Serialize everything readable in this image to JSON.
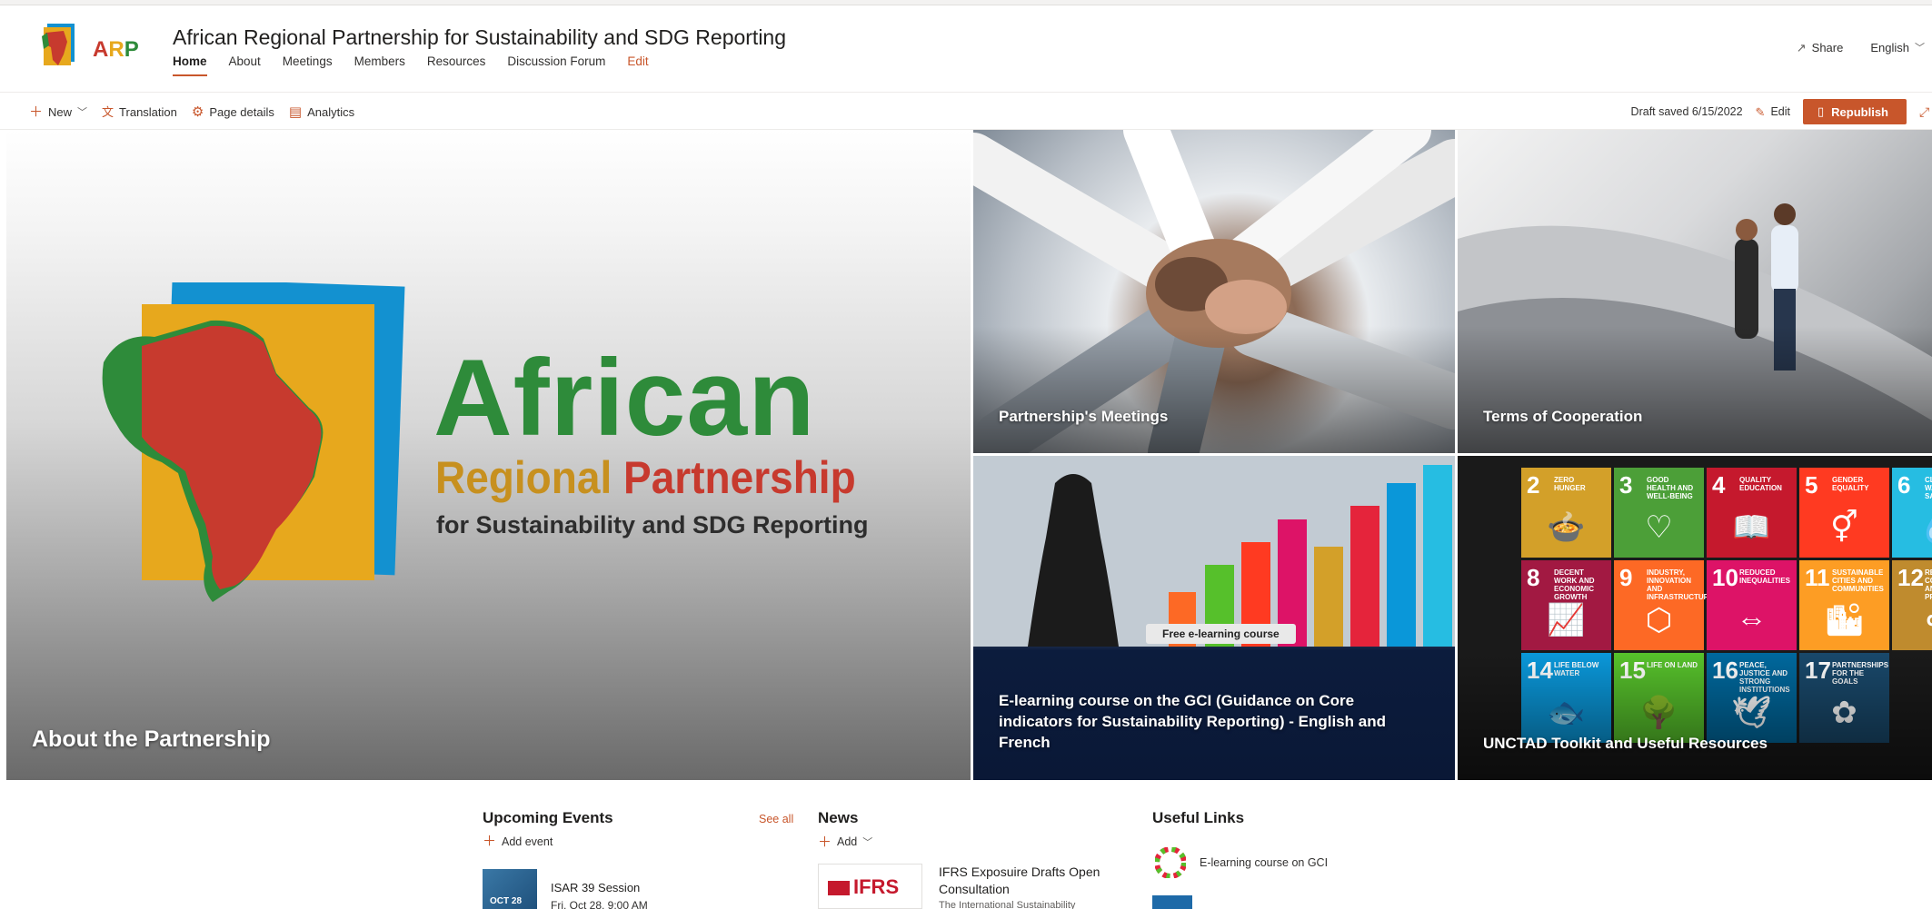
{
  "site": {
    "logo_text": "ARP",
    "title": "African Regional Partnership for Sustainability and SDG Reporting",
    "nav": [
      {
        "label": "Home",
        "active": true
      },
      {
        "label": "About"
      },
      {
        "label": "Meetings"
      },
      {
        "label": "Members"
      },
      {
        "label": "Resources"
      },
      {
        "label": "Discussion Forum"
      },
      {
        "label": "Edit"
      }
    ],
    "share_label": "Share",
    "language_label": "English"
  },
  "commandbar": {
    "new_label": "New",
    "translation_label": "Translation",
    "page_details_label": "Page details",
    "analytics_label": "Analytics",
    "draft_status": "Draft saved 6/15/2022",
    "edit_label": "Edit",
    "republish_label": "Republish"
  },
  "hero": {
    "brand": {
      "line1": "African",
      "line2a": "Regional",
      "line2b": "Partnership",
      "line3": "for Sustainability and SDG Reporting"
    },
    "tiles": [
      {
        "label": "About the Partnership"
      },
      {
        "label": "Partnership's Meetings"
      },
      {
        "label": "Terms of Cooperation"
      },
      {
        "label": "E-learning course on the GCI (Guidance on Core indicators for Sustainability Reporting) - English and French",
        "pill": "Free e-learning course"
      },
      {
        "label": "UNCTAD Toolkit and Useful Resources"
      }
    ],
    "sdg_tiles": [
      {
        "num": "2",
        "cap": "ZERO HUNGER",
        "color": "#d3a029",
        "glyph": "🍲"
      },
      {
        "num": "3",
        "cap": "GOOD HEALTH AND WELL-BEING",
        "color": "#4c9f38",
        "glyph": "♡"
      },
      {
        "num": "4",
        "cap": "QUALITY EDUCATION",
        "color": "#c5192d",
        "glyph": "📖"
      },
      {
        "num": "5",
        "cap": "GENDER EQUALITY",
        "color": "#ff3a21",
        "glyph": "⚥"
      },
      {
        "num": "6",
        "cap": "CLEAN WATER AND SANITATION",
        "color": "#26bde2",
        "glyph": "💧"
      },
      {
        "num": "8",
        "cap": "DECENT WORK AND ECONOMIC GROWTH",
        "color": "#a21942",
        "glyph": "📈"
      },
      {
        "num": "9",
        "cap": "INDUSTRY, INNOVATION AND INFRASTRUCTURE",
        "color": "#fd6925",
        "glyph": "⬡"
      },
      {
        "num": "10",
        "cap": "REDUCED INEQUALITIES",
        "color": "#dd1367",
        "glyph": "⇔"
      },
      {
        "num": "11",
        "cap": "SUSTAINABLE CITIES AND COMMUNITIES",
        "color": "#fd9d24",
        "glyph": "🏙"
      },
      {
        "num": "12",
        "cap": "RESPONSIBLE CONSUMPTION AND PRODUCTION",
        "color": "#bf8b2e",
        "glyph": "∞"
      },
      {
        "num": "14",
        "cap": "LIFE BELOW WATER",
        "color": "#0a97d9",
        "glyph": "🐟"
      },
      {
        "num": "15",
        "cap": "LIFE ON LAND",
        "color": "#56c02b",
        "glyph": "🌳"
      },
      {
        "num": "16",
        "cap": "PEACE, JUSTICE AND STRONG INSTITUTIONS",
        "color": "#00689d",
        "glyph": "🕊"
      },
      {
        "num": "17",
        "cap": "PARTNERSHIPS FOR THE GOALS",
        "color": "#19486a",
        "glyph": "✿"
      }
    ]
  },
  "events": {
    "title": "Upcoming Events",
    "see_all": "See all",
    "add_label": "Add event",
    "items": [
      {
        "badge": "OCT 28",
        "title": "ISAR 39 Session",
        "date": "Fri, Oct 28, 9:00 AM"
      }
    ]
  },
  "news": {
    "title": "News",
    "add_label": "Add",
    "items": [
      {
        "thumb_text": "IFRS",
        "title": "IFRS Exposuire Drafts Open Consultation",
        "desc": "The International Sustainability"
      }
    ]
  },
  "links": {
    "title": "Useful Links",
    "items": [
      {
        "label": "E-learning course on GCI"
      }
    ]
  },
  "colors": {
    "accent": "#c8562b",
    "africa_green": "#2e8b3a",
    "partnership_red": "#c73a2e",
    "regional_gold": "#c7901f",
    "brand_blue": "#1391d0",
    "brand_yellow": "#e7a81d"
  }
}
